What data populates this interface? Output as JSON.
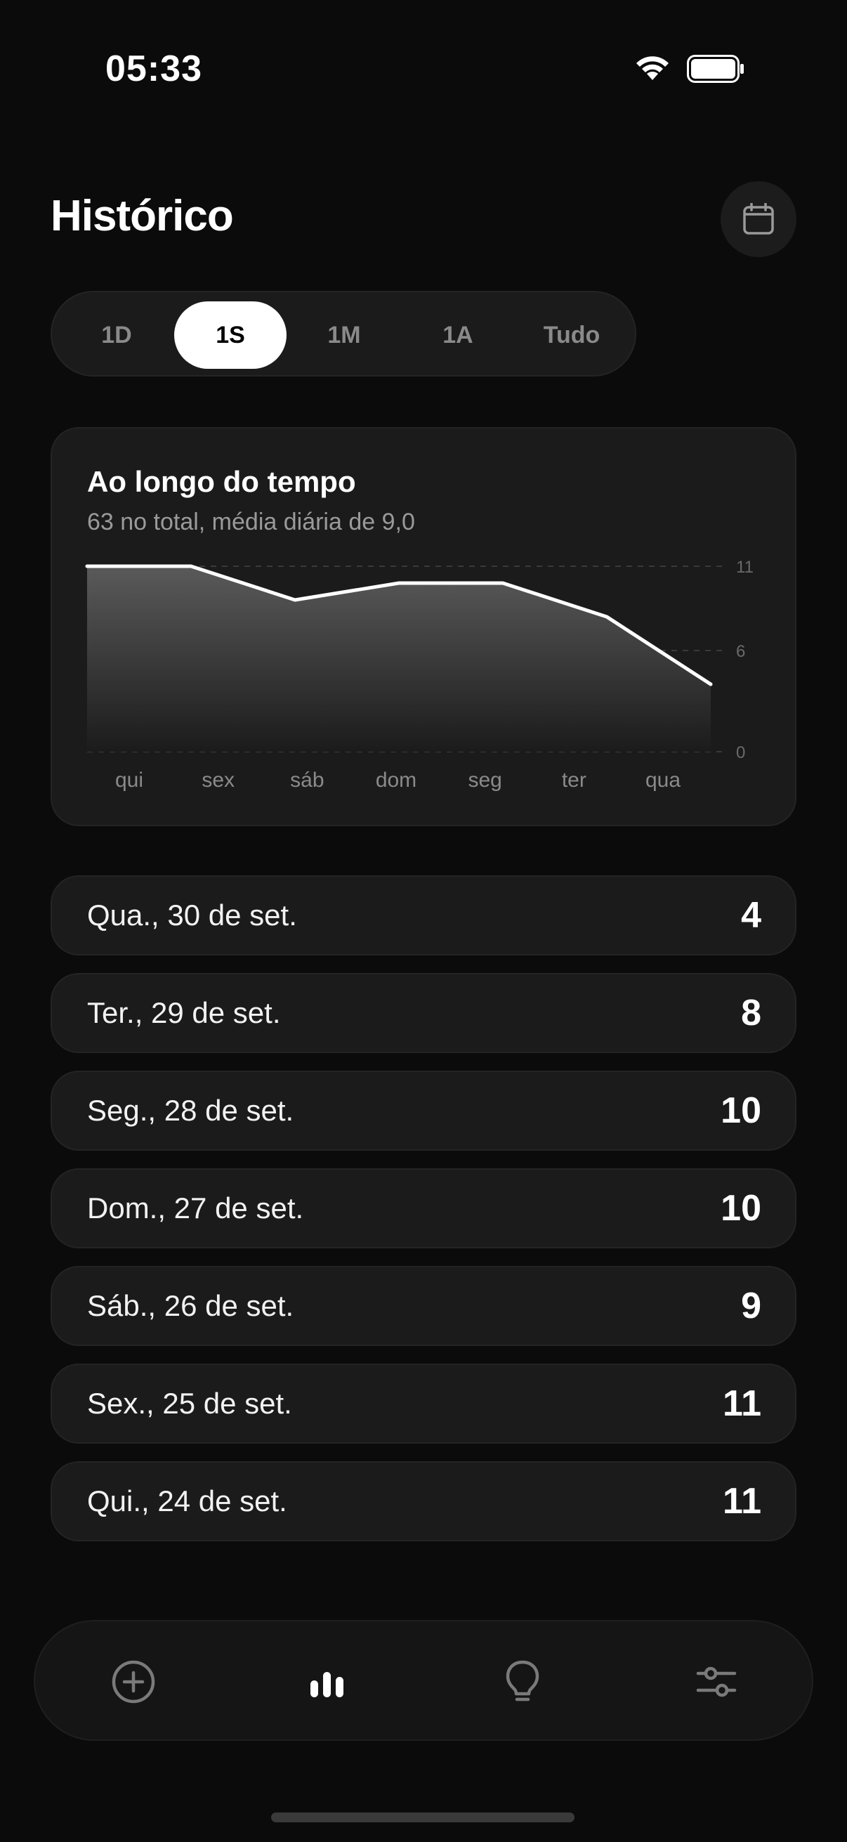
{
  "status_bar": {
    "time": "05:33"
  },
  "header": {
    "title": "Histórico"
  },
  "range_tabs": [
    {
      "label": "1D",
      "active": false
    },
    {
      "label": "1S",
      "active": true
    },
    {
      "label": "1M",
      "active": false
    },
    {
      "label": "1A",
      "active": false
    },
    {
      "label": "Tudo",
      "active": false
    }
  ],
  "chart_card": {
    "title": "Ao longo do tempo",
    "subtitle": "63 no total, média diária de 9,0"
  },
  "chart_data": {
    "type": "area",
    "categories": [
      "qui",
      "sex",
      "sáb",
      "dom",
      "seg",
      "ter",
      "qua"
    ],
    "values": [
      11,
      11,
      9,
      10,
      10,
      8,
      4
    ],
    "y_ticks": [
      "11",
      "6",
      "0"
    ],
    "ylim": [
      0,
      11
    ],
    "grid": true
  },
  "days": [
    {
      "label": "Qua., 30 de set.",
      "count": "4"
    },
    {
      "label": "Ter., 29 de set.",
      "count": "8"
    },
    {
      "label": "Seg., 28 de set.",
      "count": "10"
    },
    {
      "label": "Dom., 27 de set.",
      "count": "10"
    },
    {
      "label": "Sáb., 26 de set.",
      "count": "9"
    },
    {
      "label": "Sex., 25 de set.",
      "count": "11"
    },
    {
      "label": "Qui., 24 de set.",
      "count": "11"
    }
  ],
  "tab_bar": {
    "items": [
      {
        "icon": "plus-circle-icon",
        "active": false
      },
      {
        "icon": "bar-chart-icon",
        "active": true
      },
      {
        "icon": "lightbulb-icon",
        "active": false
      },
      {
        "icon": "sliders-icon",
        "active": false
      }
    ]
  },
  "colors": {
    "background": "#0b0b0b",
    "card": "#1b1b1b",
    "accent": "#ffffff",
    "muted": "#8a8a8a"
  }
}
